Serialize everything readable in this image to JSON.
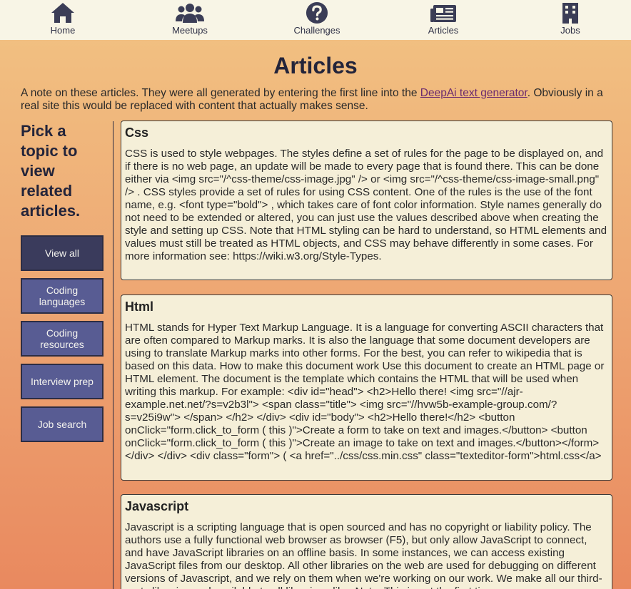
{
  "nav": {
    "items": [
      {
        "label": "Home",
        "icon": "home-icon"
      },
      {
        "label": "Meetups",
        "icon": "users-icon"
      },
      {
        "label": "Challenges",
        "icon": "question-circle-icon"
      },
      {
        "label": "Articles",
        "icon": "newspaper-icon"
      },
      {
        "label": "Jobs",
        "icon": "building-icon"
      }
    ]
  },
  "page": {
    "title": "Articles",
    "intro_before": "A note on these articles. They were all generated by entering the first line into the ",
    "intro_link": "DeepAi text generator",
    "intro_after": ". Obviously in a real site this would be replaced with content that actually makes sense."
  },
  "sidebar": {
    "heading": "Pick a topic to view related articles.",
    "buttons": [
      {
        "label": "View all",
        "active": true
      },
      {
        "label": "Coding languages",
        "active": false
      },
      {
        "label": "Coding resources",
        "active": false
      },
      {
        "label": "Interview prep",
        "active": false
      },
      {
        "label": "Job search",
        "active": false
      }
    ]
  },
  "articles": [
    {
      "title": "Css",
      "body": "CSS is used to style webpages. The styles define a set of rules for the page to be displayed on, and if there is no web page, an update will be made to every page that is found there. This can be done either via <img src=\"/^css-theme/css-image.jpg\" /> or <img src=\"/^css-theme/css-image-small.png\" /> . CSS styles provide a set of rules for using CSS content. One of the rules is the use of the font name, e.g. <font type=\"bold\"> , which takes care of font color information. Style names generally do not need to be extended or altered, you can just use the values described above when creating the style and setting up CSS. Note that HTML styling can be hard to understand, so HTML elements and values must still be treated as HTML objects, and CSS may behave differently in some cases. For more information see: https://wiki.w3.org/Style-Types."
    },
    {
      "title": "Html",
      "body": "HTML stands for Hyper Text Markup Language. It is a language for converting ASCII characters that are often compared to Markup marks. It is also the language that some document developers are using to translate Markup marks into other forms. For the best, you can refer to wikipedia that is based on this data. How to make this document work Use this document to create an HTML page or HTML element. The document is the template which contains the HTML that will be used when writing this markup. For example: <div id=\"head\"> <h2>Hello there! <img src=\"//ajr-example.net.net/?s=v2b3l\"> <span class=\"title\"> <img src=\"//hvw5b-example-group.com/?s=v25i9w\"> </span> </h2> </div> <div id=\"body\"> <h2>Hello there!</h2> <button onClick=\"form.click_to_form ( this )\">Create a form to take on text and images.</button> <button onClick=\"form.click_to_form ( this )\">Create an image to take on text and images.</button></form> </div> </div> <div class=\"form\"> ( <a href=\"../css/css.min.css\" class=\"texteditor-form\">html.css</a>"
    },
    {
      "title": "Javascript",
      "body": "Javascript is a scripting language that is open sourced and has no copyright or liability policy. The authors use a fully functional web browser as browser (F5), but only allow JavaScript to connect, and have JavaScript libraries on an offline basis. In some instances, we can access existing JavaScript files from our desktop. All other libraries on the web are used for debugging on different versions of Javascript, and we rely on them when we're working on our work. We make all our third-party libraries and available to all libraries alike. Note: This is not the first time"
    }
  ]
}
